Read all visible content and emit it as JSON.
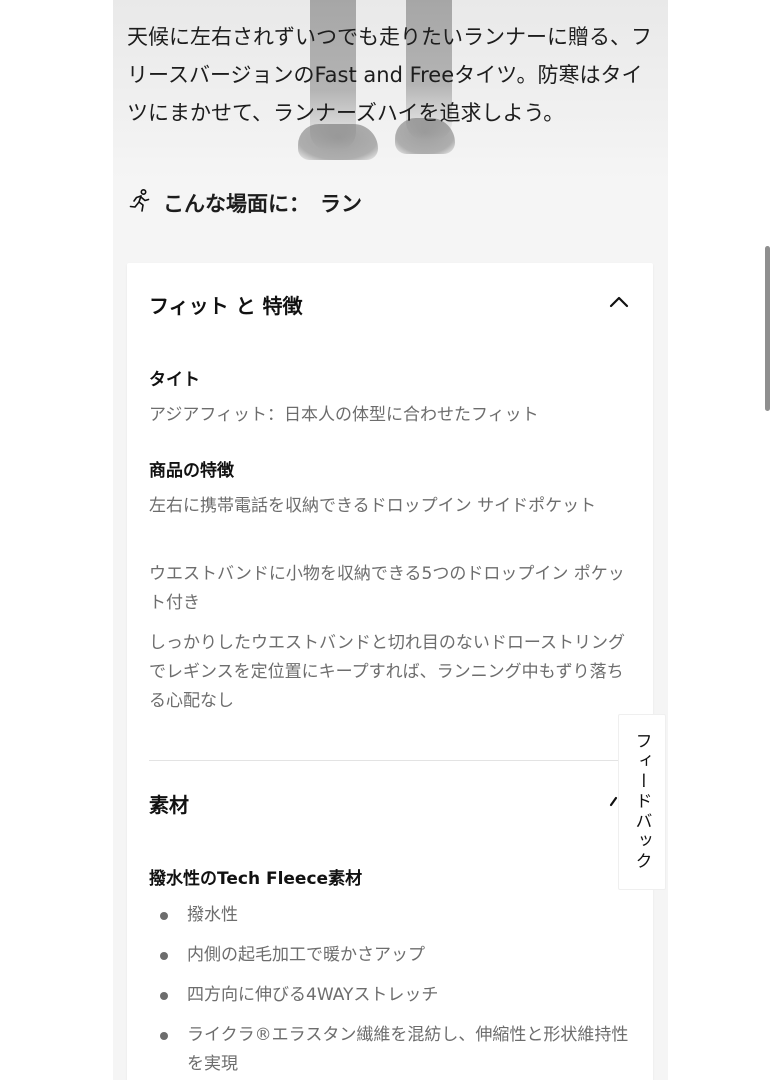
{
  "product": {
    "description": "天候に左右されずいつでも走りたいランナーに贈る、フリースバージョンのFast and Freeタイツ。防寒はタイツにまかせて、ランナーズハイを追求しよう。",
    "usage_label": "こんな場面に：",
    "usage_value": "ラン",
    "usage_icon": "runner-icon"
  },
  "fit_section": {
    "title": "フィット と 特徴",
    "toggle_icon": "chevron-up-icon",
    "expanded": true,
    "fit_title": "タイト",
    "fit_text": "アジアフィット：日本人の体型に合わせたフィット",
    "features_title": "商品の特徴",
    "features": [
      "左右に携帯電話を収納できるドロップイン サイドポケット",
      "ウエストバンドに小物を収納できる5つのドロップイン ポケット付き",
      "しっかりしたウエストバンドと切れ目のないドローストリングでレギンスを定位置にキープすれば、ランニング中もずり落ちる心配なし"
    ]
  },
  "material_section": {
    "title": "素材",
    "toggle_icon": "chevron-icon",
    "fabric_title": "撥水性のTech Fleece素材",
    "bullets": [
      "撥水性",
      "内側の起毛加工で暖かさアップ",
      "四方向に伸びる4WAYストレッチ",
      "ライクラ®エラスタン繊維を混紡し、伸縮性と形状維持性を実現"
    ]
  },
  "feedback": {
    "label": "フィードバック"
  }
}
